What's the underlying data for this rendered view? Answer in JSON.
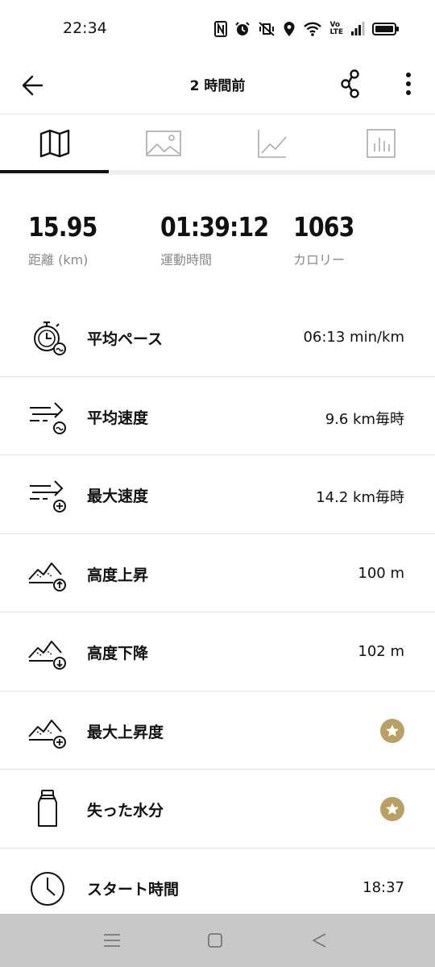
{
  "status_bar": {
    "time": "22:34",
    "icons": [
      "nfc-icon",
      "alarm-icon",
      "vibrate-icon",
      "location-icon",
      "wifi-icon",
      "volte-icon",
      "signal-icon",
      "battery-icon"
    ],
    "volte_top": "Vo",
    "volte_bottom": "LTE"
  },
  "header": {
    "title": "2 時間前",
    "icons": [
      "back-arrow-icon",
      "share-icon",
      "more-vertical-icon"
    ]
  },
  "tabs": [
    {
      "icon": "map-icon",
      "active": true
    },
    {
      "icon": "image-icon",
      "active": false
    },
    {
      "icon": "line-chart-icon",
      "active": false
    },
    {
      "icon": "bar-chart-icon",
      "active": false
    }
  ],
  "summary": {
    "distance": {
      "value": "15.95",
      "label": "距離 (km)"
    },
    "duration": {
      "value": "01:39:12",
      "label": "運動時間"
    },
    "calories": {
      "value": "1063",
      "label": "カロリー"
    }
  },
  "metrics": [
    {
      "icon": "stopwatch-pace-icon",
      "label": "平均ペース",
      "value": "06:13 min/km"
    },
    {
      "icon": "speed-average-icon",
      "label": "平均速度",
      "value": "9.6 km毎時"
    },
    {
      "icon": "speed-max-icon",
      "label": "最大速度",
      "value": "14.2 km毎時"
    },
    {
      "icon": "elevation-up-icon",
      "label": "高度上昇",
      "value": "100 m"
    },
    {
      "icon": "elevation-down-icon",
      "label": "高度下降",
      "value": "102 m"
    },
    {
      "icon": "elevation-max-icon",
      "label": "最大上昇度",
      "premium_icon": "star-badge-icon"
    },
    {
      "icon": "bottle-icon",
      "label": "失った水分",
      "premium_icon": "star-badge-icon"
    },
    {
      "icon": "clock-icon",
      "label": "スタート時間",
      "value": "18:37"
    }
  ],
  "colors": {
    "premium_badge": "#b9a164",
    "tab_indicator": "#111111",
    "nav_bar": "#c8c8c8"
  },
  "nav_bar": {
    "icons": [
      "menu-icon",
      "home-square-icon",
      "back-triangle-icon"
    ]
  }
}
